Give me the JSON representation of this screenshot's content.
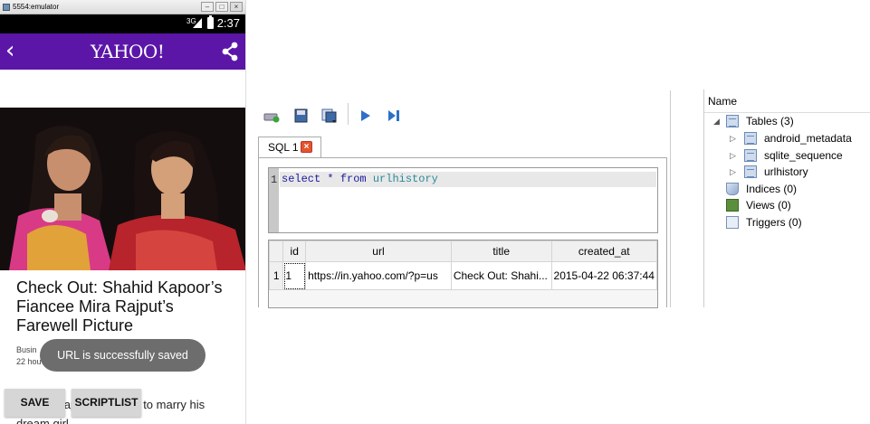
{
  "emulator": {
    "window_title": "5554:emulator",
    "status_bar": {
      "network": "3G",
      "time": "2:37"
    },
    "app_bar": {
      "logo": "YAHOO!"
    },
    "article": {
      "headline": "Check Out: Shahid Kapoor’s Fiancee Mira Rajput’s Farewell Picture",
      "meta_line1": "Busin",
      "meta_line1_hidden": "…",
      "meta_line2": "22 hou",
      "body_text": "Shahid Kapoor is all set to marry his dream girl"
    },
    "toast": "URL is successfully saved",
    "buttons": {
      "save": "SAVE",
      "scriptlist": "SCRIPTLIST"
    }
  },
  "sql_editor": {
    "tab_label": "SQL 1",
    "line_number": "1",
    "query_keywords": [
      "select",
      "*",
      "from"
    ],
    "query_table": "urlhistory",
    "results": {
      "columns": [
        "id",
        "url",
        "title",
        "created_at"
      ],
      "rows": [
        {
          "row_number": "1",
          "id": "1",
          "url": "https://in.yahoo.com/?p=us",
          "title": "Check Out: Shahi...",
          "created_at": "2015-04-22 06:37:44"
        }
      ]
    }
  },
  "tree": {
    "header": "Name",
    "tables": "Tables (3)",
    "table_items": [
      "android_metadata",
      "sqlite_sequence",
      "urlhistory"
    ],
    "indices": "Indices (0)",
    "views": "Views (0)",
    "triggers": "Triggers (0)"
  },
  "colors": {
    "app_bar": "#5b16a8",
    "toast": "#6d6d6d",
    "sql_keyword": "#1a1a9e",
    "sql_table": "#2a8a99",
    "tab_close": "#e3552a"
  }
}
